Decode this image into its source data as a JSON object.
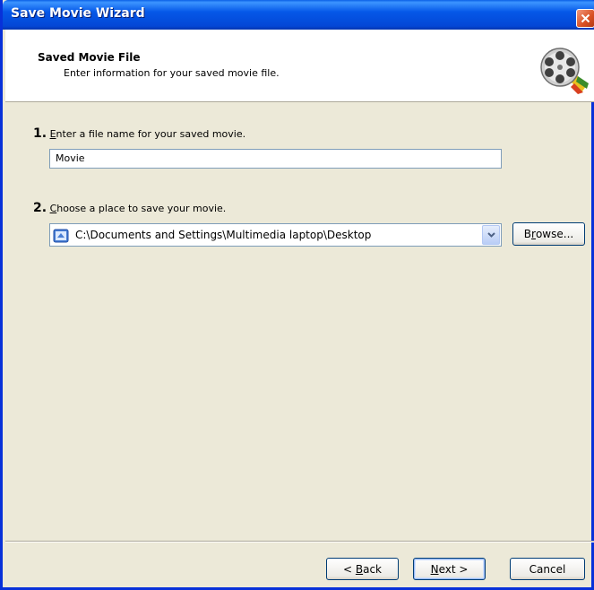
{
  "window": {
    "title": "Save Movie Wizard"
  },
  "header": {
    "title": "Saved Movie File",
    "subtitle": "Enter information for your saved movie file."
  },
  "step1": {
    "number": "1.",
    "label_underlined": "E",
    "label_rest": "nter a file name for your saved movie.",
    "filename_value": "Movie"
  },
  "step2": {
    "number": "2.",
    "label_underlined": "C",
    "label_rest": "hoose a place to save your movie.",
    "location_value": "C:\\Documents and Settings\\Multimedia laptop\\Desktop",
    "browse_underlined": "r",
    "browse_pre": "B",
    "browse_post": "owse..."
  },
  "buttons": {
    "back_pre": "< ",
    "back_underlined": "B",
    "back_post": "ack",
    "next_underlined": "N",
    "next_post": "ext >",
    "cancel": "Cancel"
  },
  "colors": {
    "titlebar": "#0558e8",
    "close": "#d94f23",
    "dialog_bg": "#ece9d8"
  },
  "icons": {
    "close": "close-icon",
    "reel": "film-reel-icon",
    "folder": "folder-icon",
    "dropdown": "chevron-down-icon"
  }
}
